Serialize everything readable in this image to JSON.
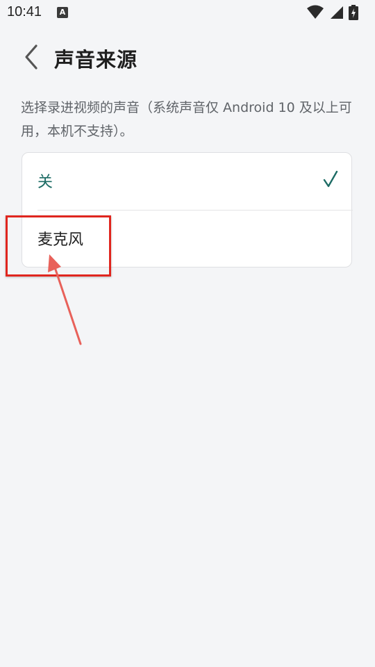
{
  "status_bar": {
    "time": "10:41",
    "notification_letter": "A",
    "icons": [
      "wifi-icon",
      "signal-icon",
      "battery-charging-icon"
    ]
  },
  "header": {
    "title": "声音来源",
    "back_icon": "chevron-left-icon"
  },
  "description": "选择录进视频的声音（系统声音仅 Android 10 及以上可用，本机不支持）。",
  "options": [
    {
      "label": "关",
      "selected": true
    },
    {
      "label": "麦克风",
      "selected": false
    }
  ],
  "colors": {
    "accent": "#1c6b64",
    "background": "#f4f5f7",
    "annotation": "#e0261f"
  }
}
